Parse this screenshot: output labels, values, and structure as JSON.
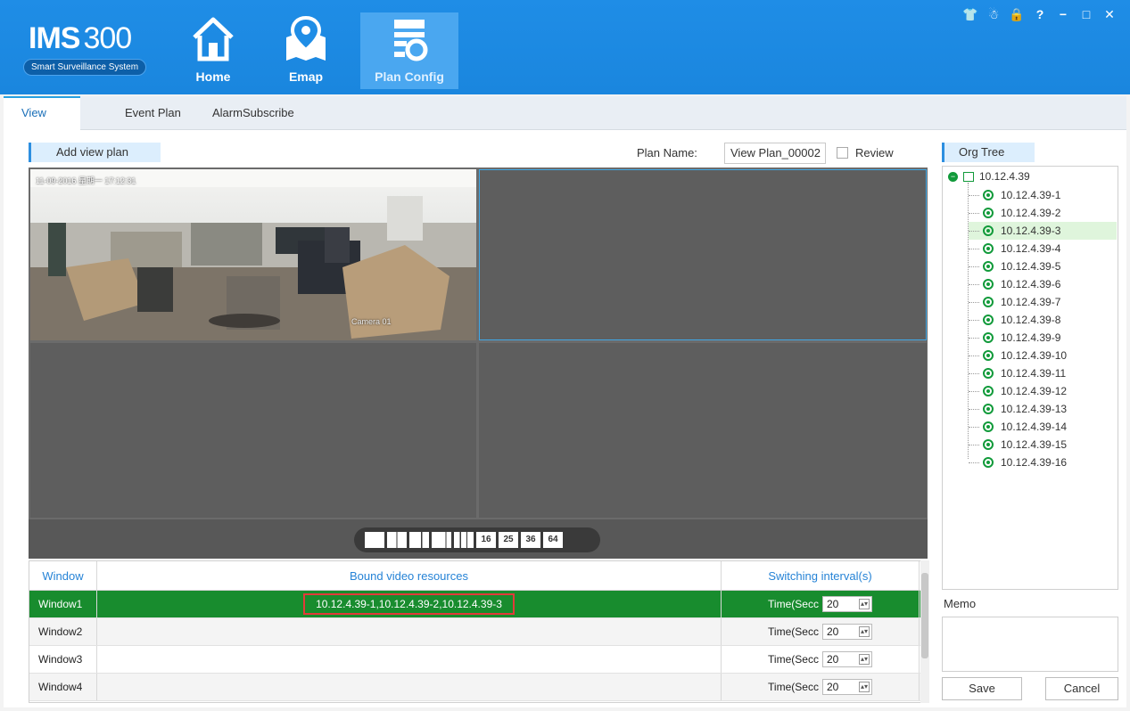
{
  "app": {
    "logo_title": "IMS",
    "logo_number": "300",
    "logo_subtitle": "Smart Surveillance System"
  },
  "nav": [
    {
      "label": "Home",
      "icon": "home-icon"
    },
    {
      "label": "Emap",
      "icon": "map-pin-icon"
    },
    {
      "label": "Plan Config",
      "icon": "plan-config-icon",
      "active": true
    }
  ],
  "window_controls": {
    "min": "−",
    "max": "□",
    "close": "✕",
    "help": "?"
  },
  "tabs": [
    {
      "label": "View Plan",
      "active": true
    },
    {
      "label": "Event Plan"
    },
    {
      "label": "AlarmSubscribe"
    }
  ],
  "toolbar": {
    "add_view_plan": "Add view plan",
    "plan_name_label": "Plan Name:",
    "plan_name_value": "View Plan_00002",
    "review_label": "Review"
  },
  "video": {
    "timestamp_overlay": "11-09-2016 星期一 17:12:31",
    "camera_overlay": "Camera 01",
    "layouts": [
      "1",
      "4",
      "6",
      "8",
      "9",
      "16",
      "25",
      "36",
      "64"
    ]
  },
  "table": {
    "headers": [
      "Window",
      "Bound video resources",
      "Switching interval(s)"
    ],
    "rows": [
      {
        "window": "Window1",
        "resources": "10.12.4.39-1,10.12.4.39-2,10.12.4.39-3",
        "time_label": "Time(Secc",
        "interval": "20",
        "selected": true
      },
      {
        "window": "Window2",
        "resources": "",
        "time_label": "Time(Secc",
        "interval": "20"
      },
      {
        "window": "Window3",
        "resources": "",
        "time_label": "Time(Secc",
        "interval": "20"
      },
      {
        "window": "Window4",
        "resources": "",
        "time_label": "Time(Secc",
        "interval": "20"
      }
    ]
  },
  "org_tree": {
    "title": "Org Tree",
    "root": "10.12.4.39",
    "items": [
      "10.12.4.39-1",
      "10.12.4.39-2",
      "10.12.4.39-3",
      "10.12.4.39-4",
      "10.12.4.39-5",
      "10.12.4.39-6",
      "10.12.4.39-7",
      "10.12.4.39-8",
      "10.12.4.39-9",
      "10.12.4.39-10",
      "10.12.4.39-11",
      "10.12.4.39-12",
      "10.12.4.39-13",
      "10.12.4.39-14",
      "10.12.4.39-15",
      "10.12.4.39-16"
    ],
    "selected_index": 2
  },
  "memo": {
    "label": "Memo"
  },
  "actions": {
    "save": "Save",
    "cancel": "Cancel"
  },
  "colors": {
    "header_blue": "#1f8de6",
    "selected_row": "#188c2e",
    "accent": "#2d8fe0",
    "highlight": "#e23a3a"
  }
}
